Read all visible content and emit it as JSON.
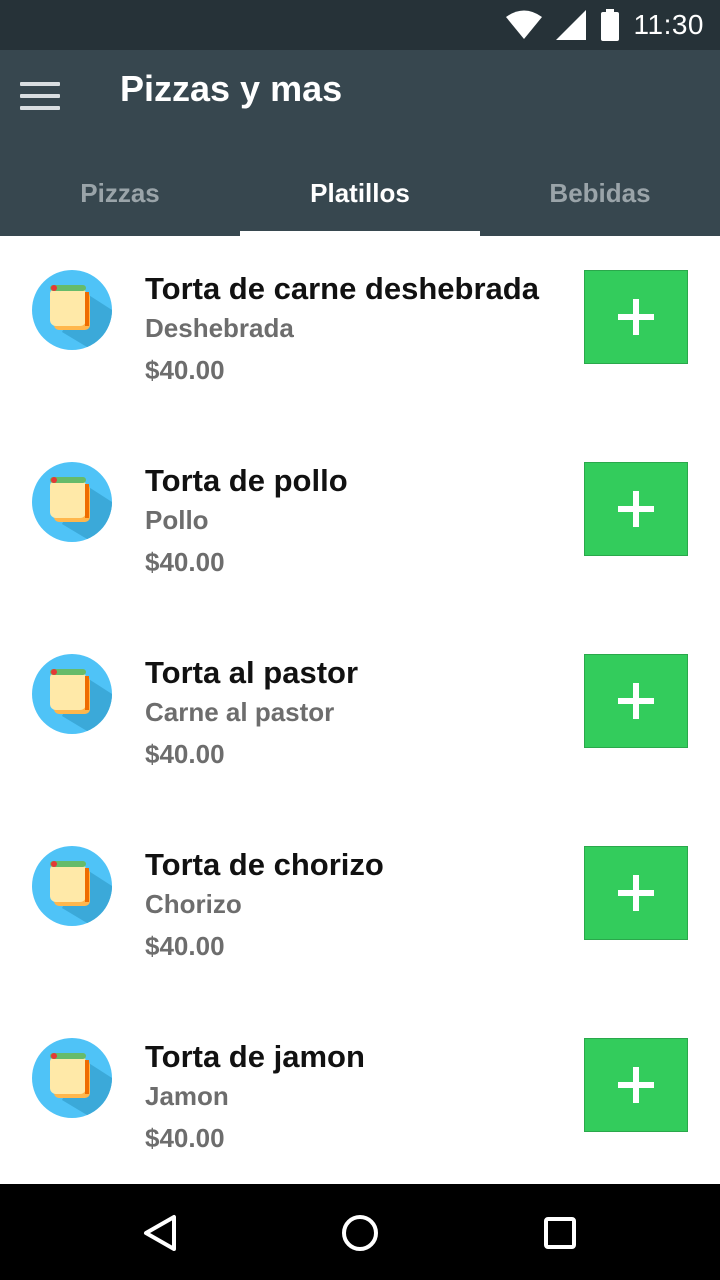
{
  "status_bar": {
    "time": "11:30",
    "icons": [
      "wifi-icon",
      "signal-icon",
      "battery-icon"
    ]
  },
  "app_bar": {
    "title": "Pizzas y mas",
    "menu_icon": "menu-icon"
  },
  "tabs": [
    {
      "label": "Pizzas",
      "active": false
    },
    {
      "label": "Platillos",
      "active": true
    },
    {
      "label": "Bebidas",
      "active": false
    }
  ],
  "items": [
    {
      "name": "Torta de carne deshebrada",
      "description": "Deshebrada",
      "price": "$40.00",
      "icon": "sandwich-icon"
    },
    {
      "name": "Torta de pollo",
      "description": "Pollo",
      "price": "$40.00",
      "icon": "sandwich-icon"
    },
    {
      "name": "Torta al pastor",
      "description": "Carne al pastor",
      "price": "$40.00",
      "icon": "sandwich-icon"
    },
    {
      "name": "Torta de chorizo",
      "description": "Chorizo",
      "price": "$40.00",
      "icon": "sandwich-icon"
    },
    {
      "name": "Torta de jamon",
      "description": "Jamon",
      "price": "$40.00",
      "icon": "sandwich-icon"
    }
  ],
  "colors": {
    "status_bar": "#263238",
    "app_bar": "#37474f",
    "add_button": "#33cc5c",
    "avatar_bg": "#4fc3f7"
  },
  "nav_bar": {
    "icons": [
      "back-icon",
      "home-icon",
      "recents-icon"
    ]
  }
}
